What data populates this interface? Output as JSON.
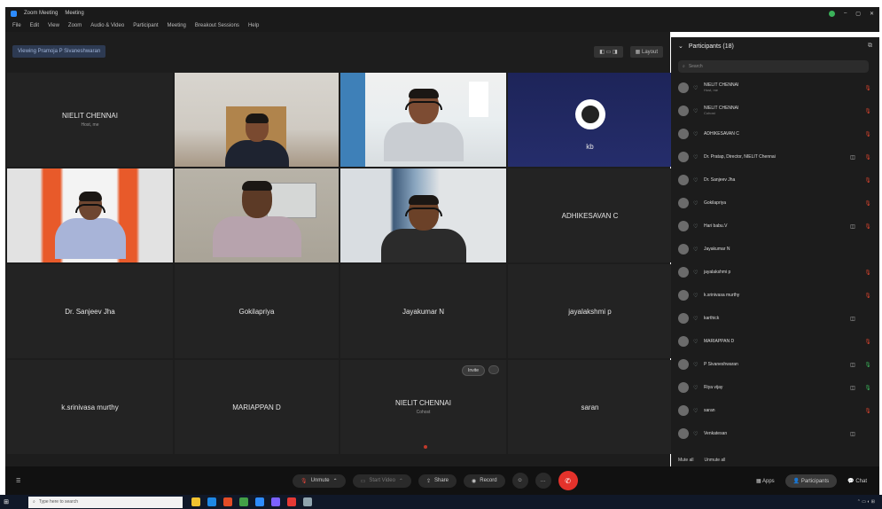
{
  "window": {
    "title": "Zoom Meeting",
    "status": "Meeting",
    "menu": [
      "File",
      "Edit",
      "View",
      "Zoom",
      "Audio & Video",
      "Participant",
      "Meeting",
      "Breakout Sessions",
      "Help"
    ]
  },
  "stage": {
    "viewing_label": "Viewing Pramoja P Sivaneshwaran",
    "layout_label": "Layout",
    "tiles": [
      {
        "kind": "name",
        "name": "NIELIT CHENNAI",
        "sub": "Host, me"
      },
      {
        "kind": "video",
        "name": ""
      },
      {
        "kind": "video",
        "name": ""
      },
      {
        "kind": "obs",
        "name": "kb"
      },
      {
        "kind": "video",
        "name": ""
      },
      {
        "kind": "video",
        "name": ""
      },
      {
        "kind": "video",
        "name": ""
      },
      {
        "kind": "name",
        "name": "ADHIKESAVAN C"
      },
      {
        "kind": "name",
        "name": "Dr. Sanjeev Jha"
      },
      {
        "kind": "name",
        "name": "Gokilapriya"
      },
      {
        "kind": "name",
        "name": "Jayakumar N"
      },
      {
        "kind": "name",
        "name": "jayalakshmi p"
      },
      {
        "kind": "name",
        "name": "k.srinivasa murthy"
      },
      {
        "kind": "name",
        "name": "MARIAPPAN D"
      },
      {
        "kind": "name",
        "name": "NIELIT CHENNAI",
        "sub": "Cohost",
        "invite": "Invite"
      },
      {
        "kind": "name",
        "name": "saran"
      }
    ]
  },
  "participants": {
    "title": "Participants (18)",
    "search_placeholder": "Search",
    "rows": [
      {
        "name": "NIELIT CHENNAI",
        "role": "Host, me",
        "cam": "",
        "mic": "off"
      },
      {
        "name": "NIELIT CHENNAI",
        "role": "Cohost",
        "cam": "",
        "mic": "off"
      },
      {
        "name": "ADHIKESAVAN C",
        "role": "",
        "cam": "",
        "mic": "off"
      },
      {
        "name": "Dr. Pratap, Director, NIELIT Chennai",
        "role": "",
        "cam": "◫",
        "mic": "off"
      },
      {
        "name": "Dr. Sanjeev Jha",
        "role": "",
        "cam": "",
        "mic": "off"
      },
      {
        "name": "Gokilapriya",
        "role": "",
        "cam": "",
        "mic": "off"
      },
      {
        "name": "Hari babu.V",
        "role": "",
        "cam": "◫",
        "mic": "off"
      },
      {
        "name": "Jayakumar N",
        "role": "",
        "cam": "",
        "mic": ""
      },
      {
        "name": "jayalakshmi p",
        "role": "",
        "cam": "",
        "mic": "off"
      },
      {
        "name": "k.srinivasa murthy",
        "role": "",
        "cam": "",
        "mic": "off"
      },
      {
        "name": "karthick",
        "role": "",
        "cam": "◫",
        "mic": ""
      },
      {
        "name": "MARIAPPAN D",
        "role": "",
        "cam": "",
        "mic": "off"
      },
      {
        "name": "P Sivaneshwaran",
        "role": "",
        "cam": "◫",
        "mic": "on"
      },
      {
        "name": "Riya vijay",
        "role": "",
        "cam": "◫",
        "mic": "on"
      },
      {
        "name": "saran",
        "role": "",
        "cam": "",
        "mic": "off"
      },
      {
        "name": "Venkatesan",
        "role": "",
        "cam": "◫",
        "mic": ""
      }
    ],
    "footer": [
      "Mute all",
      "Unmute all"
    ]
  },
  "toolbar": {
    "unmute": "Unmute",
    "start_video": "Start Video",
    "share": "Share",
    "record": "Record",
    "apps": "Apps",
    "participants": "Participants",
    "chat": "Chat"
  },
  "taskbar": {
    "search_placeholder": "Type here to search"
  },
  "colors": {
    "accent": "#2d8cff",
    "active_speaker": "#4fb6c8",
    "leave": "#e4322b",
    "muted": "#d9442e"
  }
}
